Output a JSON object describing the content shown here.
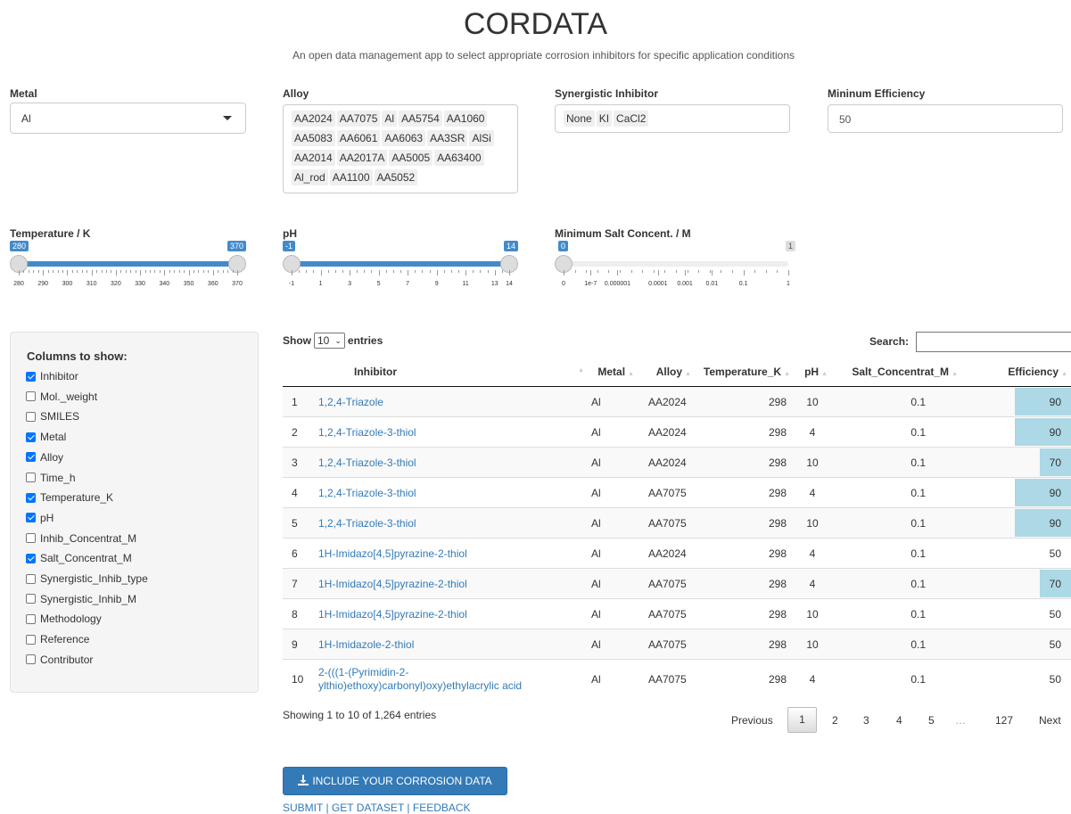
{
  "app": {
    "title": "CORDATA",
    "subtitle": "An open data management app to select appropriate corrosion inhibitors for specific application conditions"
  },
  "filters": {
    "metal": {
      "label": "Metal",
      "value": "Al"
    },
    "alloy": {
      "label": "Alloy",
      "chips": [
        "AA2024",
        "AA7075",
        "Al",
        "AA5754",
        "AA1060",
        "AA5083",
        "AA6061",
        "AA6063",
        "AA3SR",
        "AlSi",
        "AA2014",
        "AA2017A",
        "AA5005",
        "AA63400",
        "Al_rod",
        "AA1100",
        "AA5052"
      ]
    },
    "synergistic": {
      "label": "Synergistic Inhibitor",
      "chips": [
        "None",
        "KI",
        "CaCl2"
      ]
    },
    "min_efficiency": {
      "label": "Mininum Efficiency",
      "value": "50"
    }
  },
  "sliders": {
    "temperature": {
      "label": "Temperature / K",
      "min": 280,
      "max": 370,
      "low": 280,
      "high": 370,
      "low_label": "280",
      "high_label": "370",
      "ticks": [
        "280",
        "290",
        "300",
        "310",
        "320",
        "330",
        "340",
        "350",
        "360",
        "370"
      ]
    },
    "ph": {
      "label": "pH",
      "min": -1,
      "max": 14,
      "low": -1,
      "high": 14,
      "low_label": "-1",
      "high_label": "14",
      "ticks": [
        "-1",
        "1",
        "3",
        "5",
        "7",
        "9",
        "11",
        "13",
        "14"
      ]
    },
    "salt": {
      "label": "Minimum Salt Concent. / M",
      "value_label": "0",
      "max_label": "1",
      "ticks": [
        "0",
        "1e-7",
        "0.000001",
        "0.0001",
        "0.001",
        "0.01",
        "0.1",
        "1"
      ]
    }
  },
  "columns_panel": {
    "title": "Columns to show:",
    "items": [
      {
        "label": "Inhibitor",
        "checked": true
      },
      {
        "label": "Mol._weight",
        "checked": false
      },
      {
        "label": "SMILES",
        "checked": false
      },
      {
        "label": "Metal",
        "checked": true
      },
      {
        "label": "Alloy",
        "checked": true
      },
      {
        "label": "Time_h",
        "checked": false
      },
      {
        "label": "Temperature_K",
        "checked": true
      },
      {
        "label": "pH",
        "checked": true
      },
      {
        "label": "Inhib_Concentrat_M",
        "checked": false
      },
      {
        "label": "Salt_Concentrat_M",
        "checked": true
      },
      {
        "label": "Synergistic_Inhib_type",
        "checked": false
      },
      {
        "label": "Synergistic_Inhib_M",
        "checked": false
      },
      {
        "label": "Methodology",
        "checked": false
      },
      {
        "label": "Reference",
        "checked": false
      },
      {
        "label": "Contributor",
        "checked": false
      }
    ]
  },
  "table": {
    "show_label": "Show",
    "entries_value": "10",
    "entries_label": "entries",
    "search_label": "Search:",
    "headers": [
      "",
      "Inhibitor",
      "Metal",
      "Alloy",
      "Temperature_K",
      "pH",
      "Salt_Concentrat_M",
      "Efficiency"
    ],
    "rows": [
      {
        "n": "1",
        "inhibitor": "1,2,4-Triazole",
        "metal": "Al",
        "alloy": "AA2024",
        "temp": "298",
        "ph": "10",
        "salt": "0.1",
        "eff": "90",
        "eff_frac": 0.9
      },
      {
        "n": "2",
        "inhibitor": "1,2,4-Triazole-3-thiol",
        "metal": "Al",
        "alloy": "AA2024",
        "temp": "298",
        "ph": "4",
        "salt": "0.1",
        "eff": "90",
        "eff_frac": 0.9
      },
      {
        "n": "3",
        "inhibitor": "1,2,4-Triazole-3-thiol",
        "metal": "Al",
        "alloy": "AA2024",
        "temp": "298",
        "ph": "10",
        "salt": "0.1",
        "eff": "70",
        "eff_frac": 0.5
      },
      {
        "n": "4",
        "inhibitor": "1,2,4-Triazole-3-thiol",
        "metal": "Al",
        "alloy": "AA7075",
        "temp": "298",
        "ph": "4",
        "salt": "0.1",
        "eff": "90",
        "eff_frac": 0.9
      },
      {
        "n": "5",
        "inhibitor": "1,2,4-Triazole-3-thiol",
        "metal": "Al",
        "alloy": "AA7075",
        "temp": "298",
        "ph": "10",
        "salt": "0.1",
        "eff": "90",
        "eff_frac": 0.9
      },
      {
        "n": "6",
        "inhibitor": "1H-Imidazo[4,5]pyrazine-2-thiol",
        "metal": "Al",
        "alloy": "AA2024",
        "temp": "298",
        "ph": "4",
        "salt": "0.1",
        "eff": "50",
        "eff_frac": 0
      },
      {
        "n": "7",
        "inhibitor": "1H-Imidazo[4,5]pyrazine-2-thiol",
        "metal": "Al",
        "alloy": "AA7075",
        "temp": "298",
        "ph": "4",
        "salt": "0.1",
        "eff": "70",
        "eff_frac": 0.5
      },
      {
        "n": "8",
        "inhibitor": "1H-Imidazo[4,5]pyrazine-2-thiol",
        "metal": "Al",
        "alloy": "AA7075",
        "temp": "298",
        "ph": "10",
        "salt": "0.1",
        "eff": "50",
        "eff_frac": 0
      },
      {
        "n": "9",
        "inhibitor": "1H-Imidazole-2-thiol",
        "metal": "Al",
        "alloy": "AA7075",
        "temp": "298",
        "ph": "10",
        "salt": "0.1",
        "eff": "50",
        "eff_frac": 0
      },
      {
        "n": "10",
        "inhibitor": "2-(((1-(Pyrimidin-2-ylthio)ethoxy)carbonyl)oxy)ethylacrylic acid",
        "metal": "Al",
        "alloy": "AA7075",
        "temp": "298",
        "ph": "4",
        "salt": "0.1",
        "eff": "50",
        "eff_frac": 0
      }
    ],
    "info": "Showing 1 to 10 of 1,264 entries",
    "pagination": {
      "previous": "Previous",
      "current": "1",
      "pages": [
        "2",
        "3",
        "4",
        "5"
      ],
      "ellipsis": "…",
      "last": "127",
      "next": "Next"
    }
  },
  "actions": {
    "include_button": "INCLUDE YOUR CORROSION DATA",
    "links": [
      "SUBMIT",
      "GET DATASET",
      "FEEDBACK"
    ],
    "link_sep": " | "
  },
  "colors": {
    "accent": "#428bca",
    "link": "#337ab7",
    "bar": "#add8e6"
  }
}
